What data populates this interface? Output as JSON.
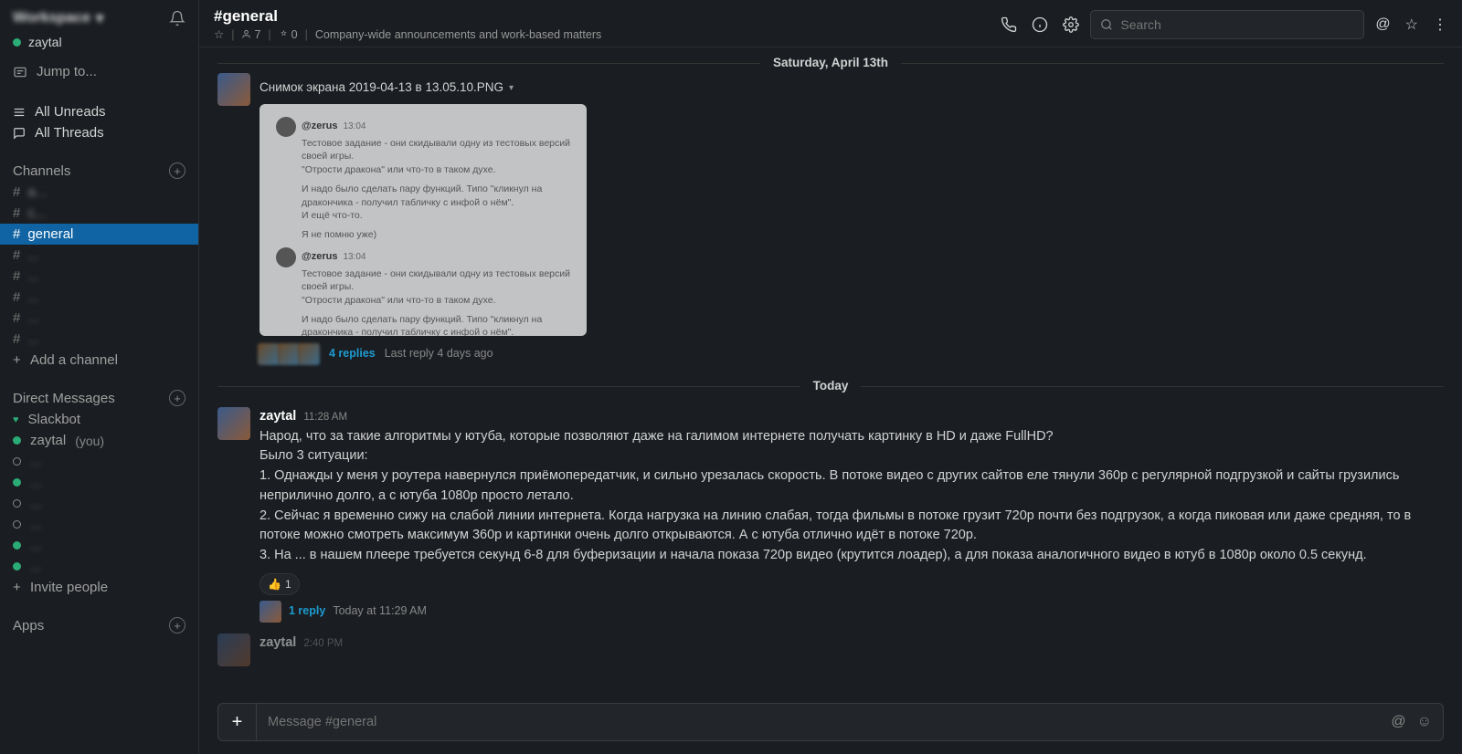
{
  "workspace": {
    "name_redacted": "Workspace",
    "user": "zaytal"
  },
  "jump_to": "Jump to...",
  "nav": {
    "all_unreads": "All Unreads",
    "all_threads": "All Threads"
  },
  "channels_header": "Channels",
  "channels": [
    {
      "name": "a...",
      "redacted": true
    },
    {
      "name": "c...",
      "redacted": true
    },
    {
      "name": "general",
      "redacted": false,
      "active": true
    },
    {
      "name": "...",
      "redacted": true
    },
    {
      "name": "...",
      "redacted": true
    },
    {
      "name": "...",
      "redacted": true
    },
    {
      "name": "...",
      "redacted": true
    },
    {
      "name": "...",
      "redacted": true
    }
  ],
  "add_channel": "Add a channel",
  "dm_header": "Direct Messages",
  "dms": [
    {
      "name": "Slackbot",
      "heart": true
    },
    {
      "name": "zaytal",
      "you": "(you)",
      "online": true
    },
    {
      "name": "...",
      "redacted": true,
      "online": false
    },
    {
      "name": "...",
      "redacted": true,
      "online": true
    },
    {
      "name": "...",
      "redacted": true,
      "online": false
    },
    {
      "name": "...",
      "redacted": true,
      "online": false
    },
    {
      "name": "...",
      "redacted": true,
      "online": true
    },
    {
      "name": "...",
      "redacted": true,
      "online": true
    }
  ],
  "invite_people": "Invite people",
  "apps_header": "Apps",
  "header": {
    "channel": "#general",
    "members": "7",
    "pins": "0",
    "topic": "Company-wide announcements and work-based matters",
    "search_placeholder": "Search"
  },
  "divider1": "Saturday, April 13th",
  "divider2": "Today",
  "msg1": {
    "file": "Снимок экрана 2019-04-13 в 13.05.10.PNG",
    "preview": {
      "author": "@zerus",
      "time": "13:04",
      "l1": "Тестовое задание - они скидывали одну из тестовых версий своей игры.",
      "l2": "\"Отрости дракона\" или что-то в таком духе.",
      "l3": "И надо было сделать пару функций. Типо \"кликнул на дракончика - получил табличку с инфой о нём\".",
      "l4": "И ещё что-то.",
      "l5": "Я не помню уже)"
    },
    "replies": "4 replies",
    "last_reply": "Last reply 4 days ago"
  },
  "msg2": {
    "author": "zaytal",
    "time": "11:28 AM",
    "p0": "Народ, что за такие алгоритмы у ютуба, которые позволяют даже на галимом интернете получать картинку в HD и даже FullHD?",
    "p1": "Было 3 ситуации:",
    "p2": "1. Однажды у меня у роутера навернулся приёмопередатчик, и сильно урезалась скорость. В потоке видео с других сайтов еле тянули 360p с регулярной подгрузкой и сайты грузились неприлично долго, а с ютуба 1080p просто летало.",
    "p3": "2. Сейчас я временно сижу на слабой линии интернета. Когда нагрузка на линию слабая, тогда фильмы в потоке грузит 720p почти без подгрузок, а когда пиковая или даже средняя, то в потоке можно смотреть максимум 360p и картинки очень долго открываются. А с ютуба отлично идёт в потоке 720p.",
    "p4": "3. На ... в нашем плеере требуется секунд 6-8 для буферизации и начала показа 720p видео (крутится лоадер), а для показа аналогичного видео в ютуб в 1080p около 0.5 секунд.",
    "reaction_emoji": "👍",
    "reaction_count": "1",
    "thread_replies": "1 reply",
    "thread_time": "Today at 11:29 AM"
  },
  "msg3": {
    "author": "zaytal",
    "time": "2:40 PM"
  },
  "composer": {
    "placeholder": "Message #general"
  }
}
